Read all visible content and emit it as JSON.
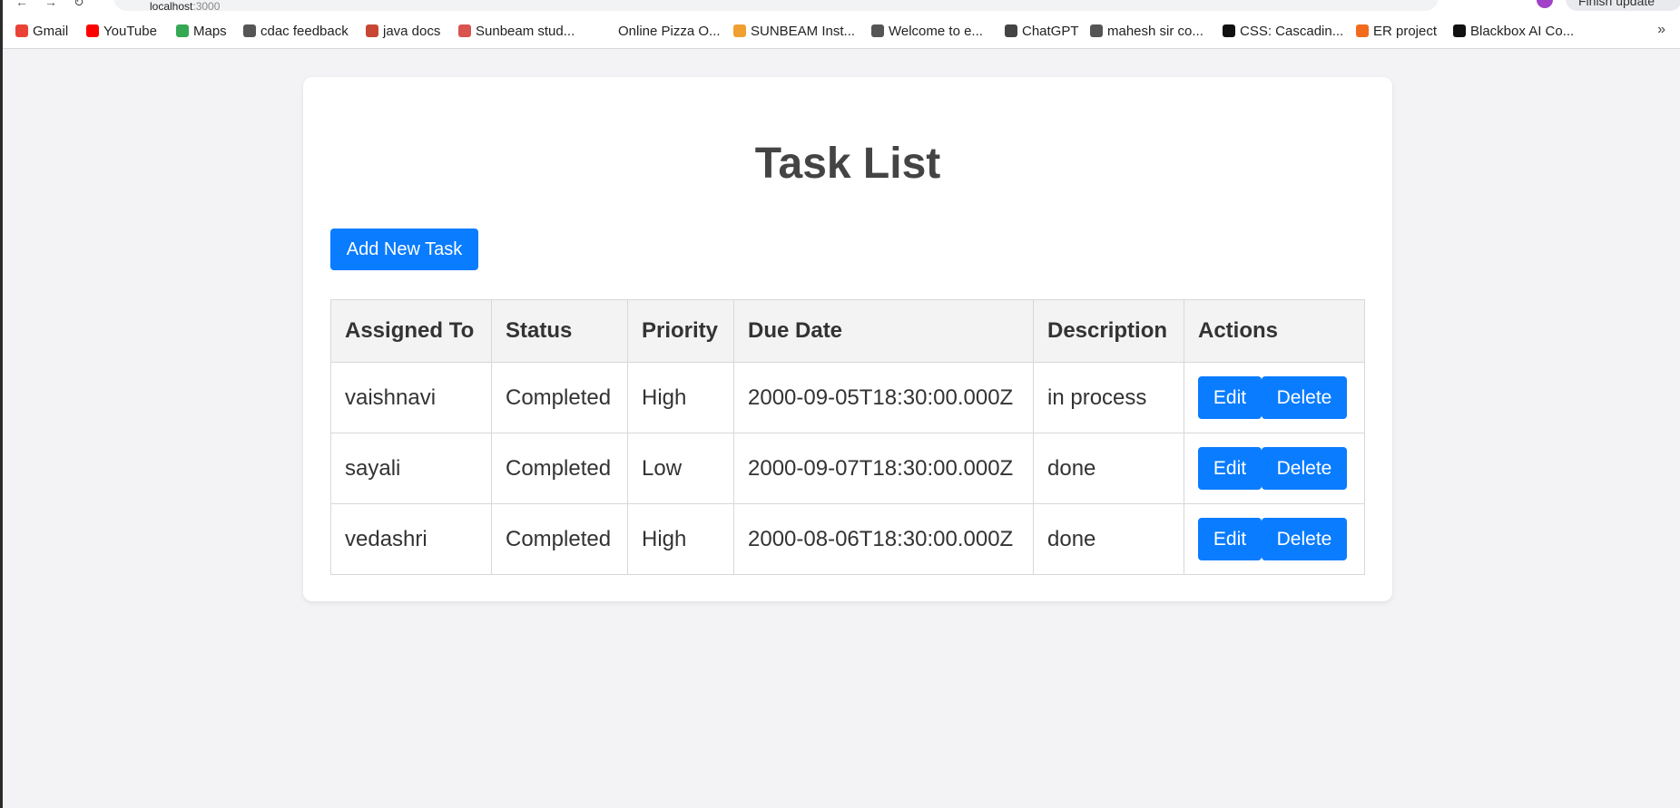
{
  "browser": {
    "url_host": "localhost",
    "url_port": ":3000",
    "update_label": "Finish update"
  },
  "bookmarks": [
    {
      "label": "Gmail",
      "icon": "gmail-icon",
      "color": "#ea4335"
    },
    {
      "label": "YouTube",
      "icon": "youtube-icon",
      "color": "#ff0000"
    },
    {
      "label": "Maps",
      "icon": "maps-icon",
      "color": "#34a853"
    },
    {
      "label": "cdac feedback",
      "icon": "globe-icon",
      "color": "#555555"
    },
    {
      "label": "java docs",
      "icon": "oracle-icon",
      "color": "#c74634"
    },
    {
      "label": "Sunbeam stud...",
      "icon": "sunbeam-icon",
      "color": "#d9534f"
    },
    {
      "label": "Online Pizza O...",
      "icon": "blank-icon",
      "color": "#ffffff"
    },
    {
      "label": "SUNBEAM Inst...",
      "icon": "sunbeam-inst-icon",
      "color": "#f0a030"
    },
    {
      "label": "Welcome to e...",
      "icon": "globe-icon",
      "color": "#555555"
    },
    {
      "label": "ChatGPT",
      "icon": "chatgpt-icon",
      "color": "#444444"
    },
    {
      "label": "mahesh sir co...",
      "icon": "globe-icon",
      "color": "#555555"
    },
    {
      "label": "CSS: Cascadin...",
      "icon": "mdn-icon",
      "color": "#111111"
    },
    {
      "label": "ER project",
      "icon": "er-icon",
      "color": "#f26b1d"
    },
    {
      "label": "Blackbox AI Co...",
      "icon": "blackbox-icon",
      "color": "#111111"
    }
  ],
  "page": {
    "title": "Task List",
    "add_button": "Add New Task"
  },
  "table": {
    "headers": [
      "Assigned To",
      "Status",
      "Priority",
      "Due Date",
      "Description",
      "Actions"
    ],
    "rows": [
      {
        "assigned": "vaishnavi",
        "status": "Completed",
        "priority": "High",
        "due": "2000-09-05T18:30:00.000Z",
        "description": "in process"
      },
      {
        "assigned": "sayali",
        "status": "Completed",
        "priority": "Low",
        "due": "2000-09-07T18:30:00.000Z",
        "description": "done"
      },
      {
        "assigned": "vedashri",
        "status": "Completed",
        "priority": "High",
        "due": "2000-08-06T18:30:00.000Z",
        "description": "done"
      }
    ],
    "edit_label": "Edit",
    "delete_label": "Delete"
  },
  "colors": {
    "accent": "#0a7cff",
    "background": "#f3f3f6"
  }
}
